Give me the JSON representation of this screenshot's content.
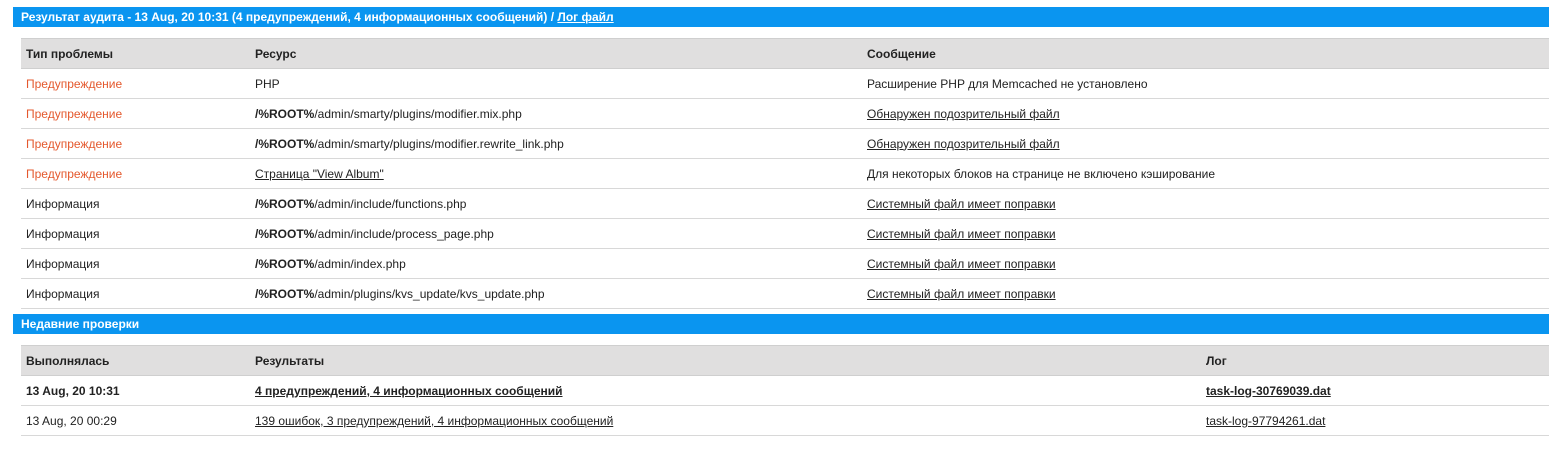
{
  "audit": {
    "header_text": "Результат аудита - 13 Aug, 20 10:31 (4 предупреждений, 4 информационных сообщений) / ",
    "header_link": "Лог файл",
    "columns": [
      "Тип проблемы",
      "Ресурс",
      "Сообщение"
    ],
    "rows": [
      {
        "type": "Предупреждение",
        "severity": "warning",
        "resource_prefix": "",
        "resource": "PHP",
        "resource_link": false,
        "message": "Расширение PHP для Memcached не установлено",
        "message_link": false
      },
      {
        "type": "Предупреждение",
        "severity": "warning",
        "resource_prefix": "/%ROOT%",
        "resource": "/admin/smarty/plugins/modifier.mix.php",
        "resource_link": false,
        "message": "Обнаружен подозрительный файл",
        "message_link": true
      },
      {
        "type": "Предупреждение",
        "severity": "warning",
        "resource_prefix": "/%ROOT%",
        "resource": "/admin/smarty/plugins/modifier.rewrite_link.php",
        "resource_link": false,
        "message": "Обнаружен подозрительный файл",
        "message_link": true
      },
      {
        "type": "Предупреждение",
        "severity": "warning",
        "resource_prefix": "",
        "resource": "Страница \"View Album\"",
        "resource_link": true,
        "message": "Для некоторых блоков на странице не включено кэширование",
        "message_link": false
      },
      {
        "type": "Информация",
        "severity": "info",
        "resource_prefix": "/%ROOT%",
        "resource": "/admin/include/functions.php",
        "resource_link": false,
        "message": "Системный файл имеет поправки",
        "message_link": true
      },
      {
        "type": "Информация",
        "severity": "info",
        "resource_prefix": "/%ROOT%",
        "resource": "/admin/include/process_page.php",
        "resource_link": false,
        "message": "Системный файл имеет поправки",
        "message_link": true
      },
      {
        "type": "Информация",
        "severity": "info",
        "resource_prefix": "/%ROOT%",
        "resource": "/admin/index.php",
        "resource_link": false,
        "message": "Системный файл имеет поправки",
        "message_link": true
      },
      {
        "type": "Информация",
        "severity": "info",
        "resource_prefix": "/%ROOT%",
        "resource": "/admin/plugins/kvs_update/kvs_update.php",
        "resource_link": false,
        "message": "Системный файл имеет поправки",
        "message_link": true
      }
    ]
  },
  "recent": {
    "header_text": "Недавние проверки",
    "columns": [
      "Выполнялась",
      "Результаты",
      "Лог"
    ],
    "rows": [
      {
        "date": "13 Aug, 20 10:31",
        "results": "4 предупреждений, 4 информационных сообщений",
        "log": "task-log-30769039.dat",
        "current": true
      },
      {
        "date": "13 Aug, 20 00:29",
        "results": "139 ошибок, 3 предупреждений, 4 информационных сообщений",
        "log": "task-log-97794261.dat",
        "current": false
      }
    ]
  },
  "colors": {
    "header_bg": "#0a95f0",
    "column_header_bg": "#e0dfdf",
    "warning_text": "#e4582d"
  }
}
